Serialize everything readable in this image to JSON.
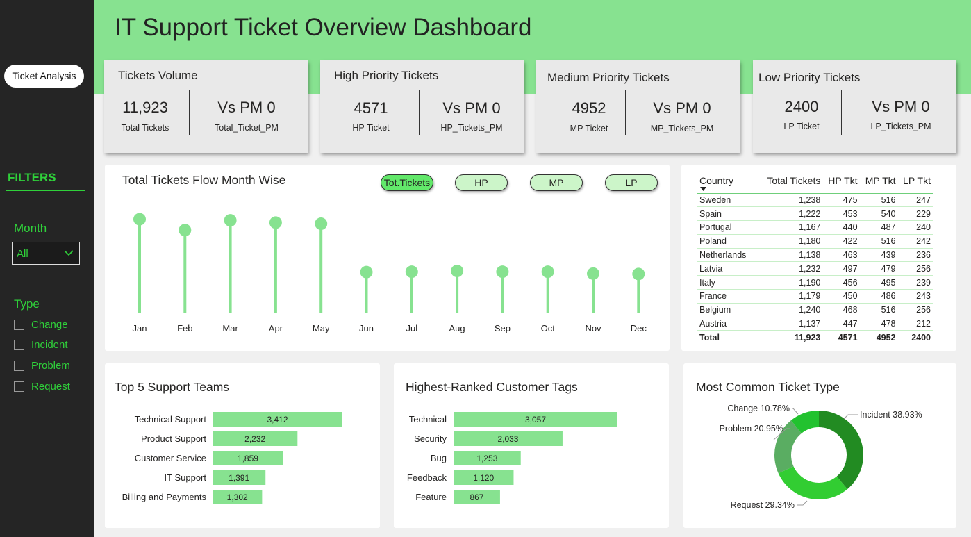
{
  "title": "IT Support Ticket Overview Dashboard",
  "nav": {
    "button": "Ticket Analysis"
  },
  "filters": {
    "title": "FILTERS",
    "month_label": "Month",
    "month_value": "All",
    "type_label": "Type",
    "types": [
      "Change",
      "Incident",
      "Problem",
      "Request"
    ]
  },
  "kpis": [
    {
      "title": "Tickets Volume",
      "value": "11,923",
      "sub": "Total Tickets",
      "vs": "Vs PM 0",
      "vs_sub": "Total_Ticket_PM"
    },
    {
      "title": "High Priority Tickets",
      "value": "4571",
      "sub": "HP Ticket",
      "vs": "Vs PM 0",
      "vs_sub": "HP_Tickets_PM"
    },
    {
      "title": "Medium Priority Tickets",
      "value": "4952",
      "sub": "MP Ticket",
      "vs": "Vs PM 0",
      "vs_sub": "MP_Tickets_PM"
    },
    {
      "title": "Low Priority Tickets",
      "value": "2400",
      "sub": "LP Ticket",
      "vs": "Vs PM 0",
      "vs_sub": "LP_Tickets_PM"
    }
  ],
  "flow": {
    "title": "Total Tickets Flow Month Wise",
    "buttons": [
      "Tot.Tickets",
      "HP",
      "MP",
      "LP"
    ]
  },
  "table": {
    "columns": [
      "Country",
      "Total Tickets",
      "HP Tkt",
      "MP Tkt",
      "LP Tkt"
    ],
    "rows": [
      [
        "Sweden",
        "1,238",
        "475",
        "516",
        "247"
      ],
      [
        "Spain",
        "1,222",
        "453",
        "540",
        "229"
      ],
      [
        "Portugal",
        "1,167",
        "440",
        "487",
        "240"
      ],
      [
        "Poland",
        "1,180",
        "422",
        "516",
        "242"
      ],
      [
        "Netherlands",
        "1,138",
        "463",
        "439",
        "236"
      ],
      [
        "Latvia",
        "1,232",
        "497",
        "479",
        "256"
      ],
      [
        "Italy",
        "1,190",
        "456",
        "495",
        "239"
      ],
      [
        "France",
        "1,179",
        "450",
        "486",
        "243"
      ],
      [
        "Belgium",
        "1,240",
        "468",
        "516",
        "256"
      ],
      [
        "Austria",
        "1,137",
        "447",
        "478",
        "212"
      ]
    ],
    "total": [
      "Total",
      "11,923",
      "4571",
      "4952",
      "2400"
    ]
  },
  "teams": {
    "title": "Top 5 Support Teams"
  },
  "tags": {
    "title": "Highest-Ranked Customer Tags"
  },
  "ticket_type": {
    "title": "Most Common Ticket Type"
  },
  "colors": {
    "accent": "#87e290",
    "bar": "#87e290",
    "filter_text": "#2fd13a",
    "sidebar": "#252525",
    "donut": [
      "#22c22f",
      "#5aad62",
      "#32cd32",
      "#228b22"
    ]
  },
  "chart_data": [
    {
      "type": "line",
      "subtype": "lollipop",
      "title": "Total Tickets Flow Month Wise",
      "categories": [
        "Jan",
        "Feb",
        "Mar",
        "Apr",
        "May",
        "Jun",
        "Jul",
        "Aug",
        "Sep",
        "Oct",
        "Nov",
        "Dec"
      ],
      "values": [
        1245,
        1100,
        1230,
        1200,
        1185,
        540,
        545,
        555,
        545,
        545,
        520,
        515
      ],
      "ylim": [
        0,
        1300
      ]
    },
    {
      "type": "bar",
      "orientation": "horizontal",
      "title": "Top 5 Support Teams",
      "categories": [
        "Technical Support",
        "Product Support",
        "Customer Service",
        "IT Support",
        "Billing and Payments"
      ],
      "values": [
        3412,
        2232,
        1859,
        1391,
        1302
      ],
      "labels": [
        "3,412",
        "2,232",
        "1,859",
        "1,391",
        "1,302"
      ],
      "xlim": [
        0,
        3412
      ]
    },
    {
      "type": "bar",
      "orientation": "horizontal",
      "title": "Highest-Ranked Customer Tags",
      "categories": [
        "Technical",
        "Security",
        "Bug",
        "Feedback",
        "Feature"
      ],
      "values": [
        3057,
        2033,
        1253,
        1120,
        867
      ],
      "labels": [
        "3,057",
        "2,033",
        "1,253",
        "1,120",
        "867"
      ],
      "xlim": [
        0,
        3057
      ]
    },
    {
      "type": "pie",
      "subtype": "donut",
      "title": "Most Common Ticket Type",
      "slices": [
        {
          "label": "Change",
          "value": 10.78,
          "text": "Change 10.78%"
        },
        {
          "label": "Problem",
          "value": 20.95,
          "text": "Problem 20.95%"
        },
        {
          "label": "Request",
          "value": 29.34,
          "text": "Request 29.34%"
        },
        {
          "label": "Incident",
          "value": 38.93,
          "text": "Incident 38.93%"
        }
      ]
    }
  ]
}
